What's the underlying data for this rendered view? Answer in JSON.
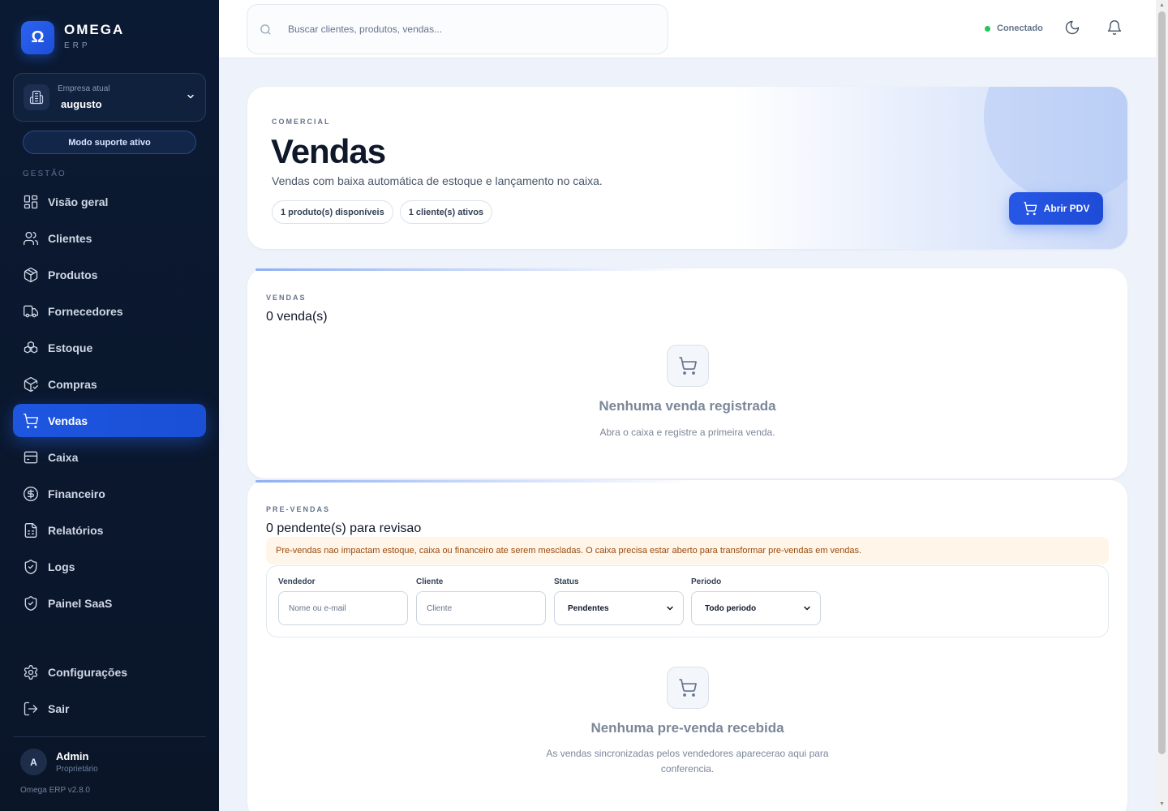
{
  "brand": {
    "name": "OMEGA",
    "sub": "ERP",
    "logo_glyph": "Ω"
  },
  "company": {
    "label": "Empresa atual",
    "name": "augusto"
  },
  "support_mode": "Modo suporte ativo",
  "sidebar": {
    "section_label": "GESTÃO",
    "items": [
      {
        "label": "Visão geral",
        "icon": "dashboard-icon"
      },
      {
        "label": "Clientes",
        "icon": "users-icon"
      },
      {
        "label": "Produtos",
        "icon": "package-icon"
      },
      {
        "label": "Fornecedores",
        "icon": "truck-icon"
      },
      {
        "label": "Estoque",
        "icon": "boxes-icon"
      },
      {
        "label": "Compras",
        "icon": "package-check-icon"
      },
      {
        "label": "Vendas",
        "icon": "cart-icon",
        "active": true
      },
      {
        "label": "Caixa",
        "icon": "cash-register-icon"
      },
      {
        "label": "Financeiro",
        "icon": "dollar-circle-icon"
      },
      {
        "label": "Relatórios",
        "icon": "report-icon"
      },
      {
        "label": "Logs",
        "icon": "shield-icon"
      },
      {
        "label": "Painel SaaS",
        "icon": "shield-check-icon"
      }
    ],
    "bottom": [
      {
        "label": "Configurações",
        "icon": "gear-icon"
      },
      {
        "label": "Sair",
        "icon": "logout-icon"
      }
    ]
  },
  "user": {
    "initial": "A",
    "name": "Admin",
    "role": "Proprietário"
  },
  "version": "Omega ERP v2.8.0",
  "topbar": {
    "search_placeholder": "Buscar clientes, produtos, vendas...",
    "status": "Conectado"
  },
  "hero": {
    "eyebrow": "COMERCIAL",
    "title": "Vendas",
    "description": "Vendas com baixa automática de estoque e lançamento no caixa.",
    "chips": [
      "1 produto(s) disponíveis",
      "1 cliente(s) ativos"
    ],
    "button": "Abrir PDV"
  },
  "sales": {
    "eyebrow": "VENDAS",
    "title": "0 venda(s)",
    "empty_title": "Nenhuma venda registrada",
    "empty_desc": "Abra o caixa e registre a primeira venda."
  },
  "presales": {
    "eyebrow": "PRE-VENDAS",
    "title": "0 pendente(s) para revisao",
    "notice": "Pre-vendas nao impactam estoque, caixa ou financeiro ate serem mescladas. O caixa precisa estar aberto para transformar pre-vendas em vendas.",
    "filters": {
      "vendedor_label": "Vendedor",
      "vendedor_placeholder": "Nome ou e-mail",
      "cliente_label": "Cliente",
      "cliente_placeholder": "Cliente",
      "status_label": "Status",
      "status_value": "Pendentes",
      "periodo_label": "Periodo",
      "periodo_value": "Todo periodo"
    },
    "empty_title": "Nenhuma pre-venda recebida",
    "empty_desc": "As vendas sincronizadas pelos vendedores aparecerao aqui para conferencia."
  },
  "colors": {
    "accent": "#1e56e0",
    "sidebar_bg": "#0b1a33",
    "online": "#22c55e",
    "notice_bg": "#fff5e9"
  }
}
